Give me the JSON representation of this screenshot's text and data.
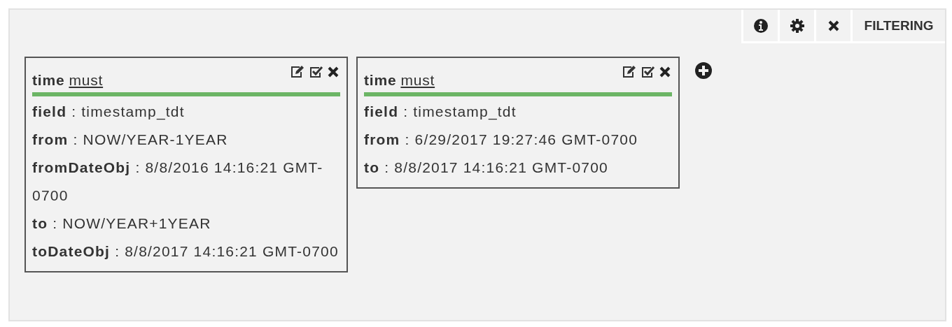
{
  "toolbar": {
    "label": "FILTERING"
  },
  "filters": [
    {
      "field": "time",
      "occur": "must",
      "properties": [
        "**field** : timestamp_tdt",
        "**from** : NOW/YEAR-1YEAR",
        "**fromDateObj** : 8/8/2016 14:16:21 GMT-0700",
        "**to** : NOW/YEAR+1YEAR",
        "**toDateObj** : 8/8/2017 14:16:21 GMT-0700"
      ]
    },
    {
      "field": "time",
      "occur": "must",
      "properties": [
        "**field** : timestamp_tdt",
        "**from** : 6/29/2017 19:27:46 GMT-0700",
        "**to** : 8/8/2017 14:16:21 GMT-0700"
      ]
    }
  ]
}
